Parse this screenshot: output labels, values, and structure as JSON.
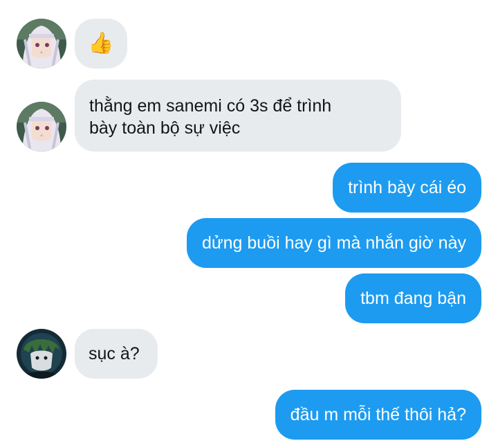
{
  "conversation": {
    "messages": [
      {
        "sender": "tengen",
        "direction": "incoming",
        "text": "👍"
      },
      {
        "sender": "tengen",
        "direction": "incoming",
        "text": "thằng em sanemi có 3s để trình bày toàn bộ sự việc",
        "lines": [
          "thằng em sanemi có 3s để trình",
          "bày toàn bộ sự việc"
        ]
      },
      {
        "sender": "me",
        "direction": "outgoing",
        "text": "trình bày cái éo"
      },
      {
        "sender": "me",
        "direction": "outgoing",
        "text": "dửng buồi hay gì mà nhắn giờ này"
      },
      {
        "sender": "me",
        "direction": "outgoing",
        "text": "tbm đang bận"
      },
      {
        "sender": "genya",
        "direction": "incoming",
        "text": "sục à?"
      },
      {
        "sender": "me",
        "direction": "outgoing",
        "text": "đầu m mỗi thế thôi hả?"
      }
    ]
  },
  "colors": {
    "outgoing_bubble": "#1d9bf0",
    "incoming_bubble": "#e8ebee",
    "outgoing_text": "#ffffff",
    "incoming_text": "#141414",
    "background": "#ffffff"
  },
  "icons": {
    "avatar_1": "avatar-white-haired-character",
    "avatar_2": "avatar-white-haired-character",
    "avatar_3": "avatar-dark-green-character"
  }
}
